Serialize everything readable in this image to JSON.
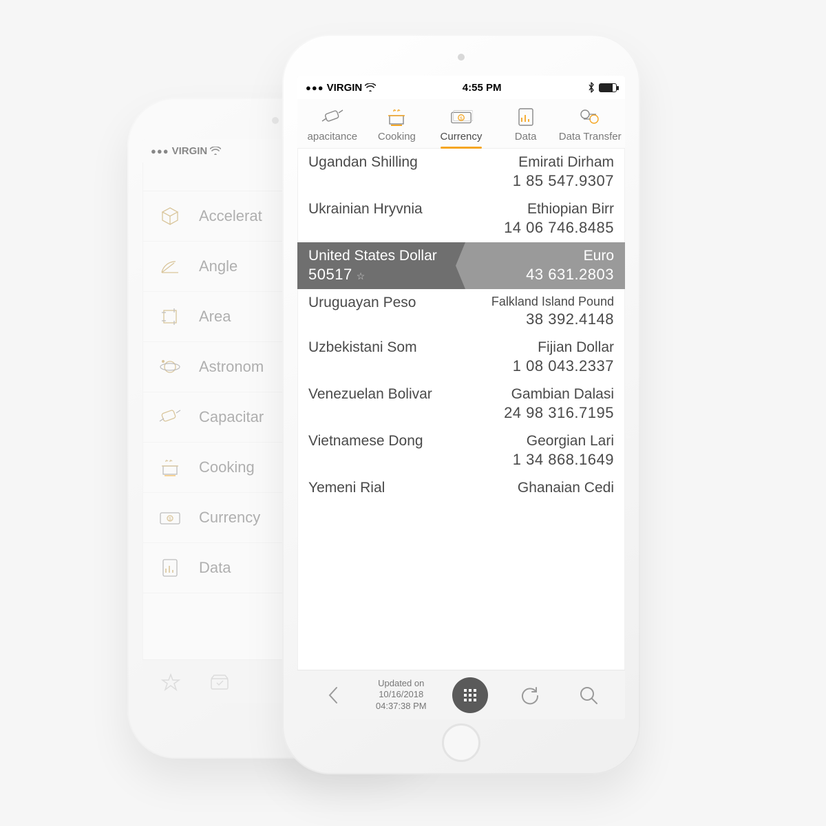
{
  "status": {
    "carrier": "VIRGIN",
    "time": "4:55 PM"
  },
  "tabs": [
    {
      "label": "apacitance"
    },
    {
      "label": "Cooking"
    },
    {
      "label": "Currency"
    },
    {
      "label": "Data"
    },
    {
      "label": "Data Transfer"
    }
  ],
  "rows": [
    {
      "left": "Ugandan Shilling",
      "right": "Emirati Dirham",
      "value": "1 85 547.9307"
    },
    {
      "left": "Ukrainian Hryvnia",
      "right": "Ethiopian Birr",
      "value": "14 06 746.8485"
    },
    {
      "left": "United States Dollar",
      "leftValue": "50517",
      "right": "Euro",
      "value": "43 631.2803"
    },
    {
      "left": "Uruguayan Peso",
      "right": "Falkland Island Pound",
      "value": "38 392.4148"
    },
    {
      "left": "Uzbekistani Som",
      "right": "Fijian Dollar",
      "value": "1 08 043.2337"
    },
    {
      "left": "Venezuelan Bolivar",
      "right": "Gambian Dalasi",
      "value": "24 98 316.7195"
    },
    {
      "left": "Vietnamese Dong",
      "right": "Georgian Lari",
      "value": "1 34 868.1649"
    },
    {
      "left": "Yemeni Rial",
      "right": "Ghanaian Cedi",
      "value": ""
    }
  ],
  "updated": {
    "line1": "Updated on",
    "line2": "10/16/2018",
    "line3": "04:37:38 PM"
  },
  "backPhone": {
    "categories": [
      "Accelerat",
      "Angle",
      "Area",
      "Astronom",
      "Capacitar",
      "Cooking",
      "Currency",
      "Data"
    ]
  },
  "colors": {
    "accent": "#f5a623",
    "selectedRow": "#6f6f6f"
  }
}
